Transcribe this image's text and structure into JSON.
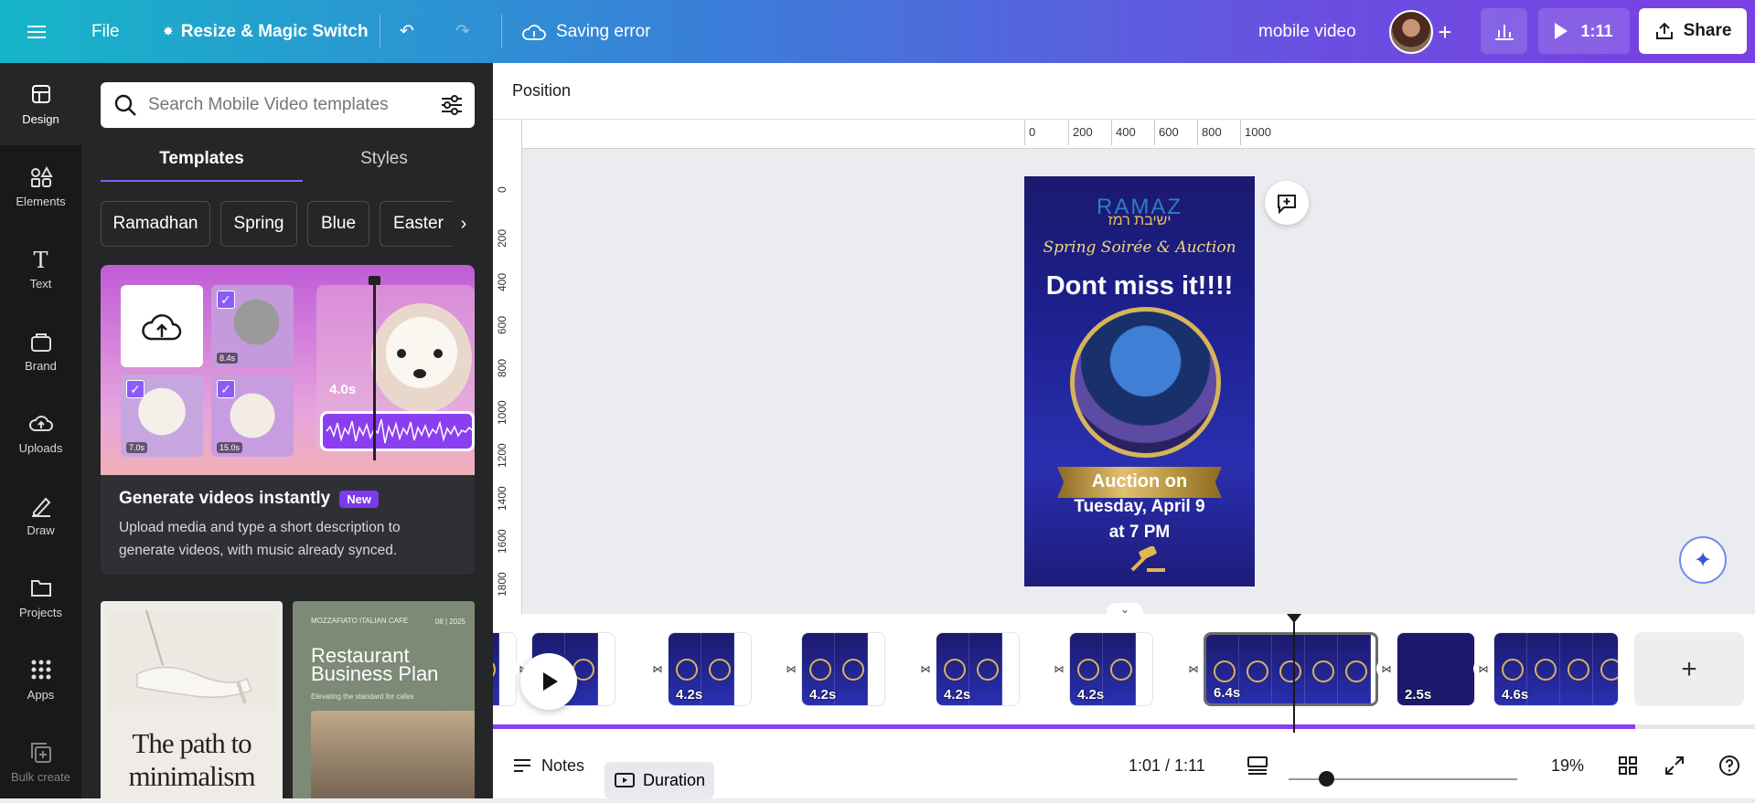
{
  "topbar": {
    "file_label": "File",
    "resize_label": "Resize & Magic Switch",
    "save_status": "Saving error",
    "document_title": "mobile video",
    "play_duration": "1:11",
    "share_label": "Share"
  },
  "rail": {
    "items": [
      {
        "label": "Design",
        "icon": "design-icon"
      },
      {
        "label": "Elements",
        "icon": "elements-icon"
      },
      {
        "label": "Text",
        "icon": "text-icon"
      },
      {
        "label": "Brand",
        "icon": "brand-icon"
      },
      {
        "label": "Uploads",
        "icon": "uploads-icon"
      },
      {
        "label": "Draw",
        "icon": "draw-icon"
      },
      {
        "label": "Projects",
        "icon": "projects-icon"
      },
      {
        "label": "Apps",
        "icon": "apps-icon"
      },
      {
        "label": "Bulk create",
        "icon": "bulk-create-icon"
      }
    ]
  },
  "panel": {
    "search_placeholder": "Search Mobile Video templates",
    "tabs": [
      "Templates",
      "Styles"
    ],
    "chips": [
      "Ramadhan",
      "Spring",
      "Blue",
      "Easter"
    ],
    "promo": {
      "durations": [
        "8.4s",
        "7.0s",
        "15.0s"
      ],
      "big_duration": "4.0s",
      "title": "Generate videos instantly",
      "badge": "New",
      "description": "Upload media and type a short description to generate videos, with music already synced."
    },
    "cards": [
      {
        "title": "The path to minimalism",
        "title_italic_word": "to"
      },
      {
        "brand": "MOZZAFIATO ITALIAN CAFE",
        "date": "08 | 2025",
        "title": "Restaurant Business Plan",
        "subtitle": "Elevating the standard for cafes"
      }
    ]
  },
  "context_bar": {
    "position_label": "Position"
  },
  "rulers": {
    "top": [
      "0",
      "200",
      "400",
      "600",
      "800",
      "1000"
    ],
    "left": [
      "0",
      "200",
      "400",
      "600",
      "800",
      "1000",
      "1200",
      "1400",
      "1600",
      "1800"
    ]
  },
  "canvas": {
    "logo": "RAMAZ",
    "hebrew": "ישיבת רמז",
    "script": "Spring Soirée & Auction",
    "headline": "Dont miss it!!!!",
    "ribbon": "Auction on",
    "line2": "Tuesday, April 9",
    "line3": "at 7 PM"
  },
  "timeline": {
    "clips": [
      {
        "duration": ""
      },
      {
        "duration": "4.2s"
      },
      {
        "duration": "4.2s"
      },
      {
        "duration": "4.2s"
      },
      {
        "duration": "4.2s"
      },
      {
        "duration": "6.4s"
      },
      {
        "duration": "2.5s"
      },
      {
        "duration": "4.6s"
      }
    ],
    "progress_percent": 90.5
  },
  "bottombar": {
    "notes_label": "Notes",
    "duration_label": "Duration",
    "time_readout": "1:01 / 1:11",
    "zoom_level": "19%",
    "zoom_percent": 19
  }
}
